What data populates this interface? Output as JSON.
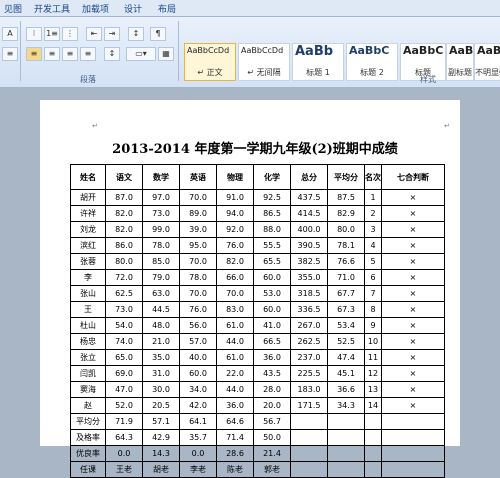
{
  "ribbon": {
    "tabs": [
      "见图",
      "开发工具",
      "加载项",
      "设计",
      "布局"
    ],
    "groups": {
      "paragraph": "段落",
      "styles": "样式"
    },
    "styles": [
      {
        "sample": "AaBbCcDd",
        "name": "↵ 正文"
      },
      {
        "sample": "AaBbCcDd",
        "name": "↵ 无间隔"
      },
      {
        "sample": "AaBb",
        "name": "标题 1"
      },
      {
        "sample": "AaBbC",
        "name": "标题 2"
      },
      {
        "sample": "AaBbC",
        "name": "标题"
      },
      {
        "sample": "AaBbC",
        "name": "副标题"
      },
      {
        "sample": "AaBbC",
        "name": "不明显强调"
      }
    ]
  },
  "document": {
    "title": "2013-2014 年度第一学期九年级(2)班期中成绩",
    "headers": [
      "姓名",
      "语文",
      "数学",
      "英语",
      "物理",
      "化学",
      "总分",
      "平均分",
      "名次",
      "七合判断"
    ],
    "rows": [
      [
        "胡开",
        "87.0",
        "97.0",
        "70.0",
        "91.0",
        "92.5",
        "437.5",
        "87.5",
        "1",
        "×"
      ],
      [
        "许祥",
        "82.0",
        "73.0",
        "89.0",
        "94.0",
        "86.5",
        "414.5",
        "82.9",
        "2",
        "×"
      ],
      [
        "刘龙",
        "82.0",
        "99.0",
        "39.0",
        "92.0",
        "88.0",
        "400.0",
        "80.0",
        "3",
        "×"
      ],
      [
        "滨红",
        "86.0",
        "78.0",
        "95.0",
        "76.0",
        "55.5",
        "390.5",
        "78.1",
        "4",
        "×"
      ],
      [
        "张蓉",
        "80.0",
        "85.0",
        "70.0",
        "82.0",
        "65.5",
        "382.5",
        "76.6",
        "5",
        "×"
      ],
      [
        "李",
        "72.0",
        "79.0",
        "78.0",
        "66.0",
        "60.0",
        "355.0",
        "71.0",
        "6",
        "×"
      ],
      [
        "张山",
        "62.5",
        "63.0",
        "70.0",
        "70.0",
        "53.0",
        "318.5",
        "67.7",
        "7",
        "×"
      ],
      [
        "王",
        "73.0",
        "44.5",
        "76.0",
        "83.0",
        "60.0",
        "336.5",
        "67.3",
        "8",
        "×"
      ],
      [
        "杜山",
        "54.0",
        "48.0",
        "56.0",
        "61.0",
        "41.0",
        "267.0",
        "53.4",
        "9",
        "×"
      ],
      [
        "杨忠",
        "74.0",
        "21.0",
        "57.0",
        "44.0",
        "66.5",
        "262.5",
        "52.5",
        "10",
        "×"
      ],
      [
        "张立",
        "65.0",
        "35.0",
        "40.0",
        "61.0",
        "36.0",
        "237.0",
        "47.4",
        "11",
        "×"
      ],
      [
        "闫凯",
        "69.0",
        "31.0",
        "60.0",
        "22.0",
        "43.5",
        "225.5",
        "45.1",
        "12",
        "×"
      ],
      [
        "窦海",
        "47.0",
        "30.0",
        "34.0",
        "44.0",
        "28.0",
        "183.0",
        "36.6",
        "13",
        "×"
      ],
      [
        "赵",
        "52.0",
        "20.5",
        "42.0",
        "36.0",
        "20.0",
        "171.5",
        "34.3",
        "14",
        "×"
      ],
      [
        "平均分",
        "71.9",
        "57.1",
        "64.1",
        "64.6",
        "56.7",
        "",
        "",
        "",
        ""
      ],
      [
        "及格率",
        "64.3",
        "42.9",
        "35.7",
        "71.4",
        "50.0",
        "",
        "",
        "",
        ""
      ],
      [
        "优良率",
        "0.0",
        "14.3",
        "0.0",
        "28.6",
        "21.4",
        "",
        "",
        "",
        ""
      ],
      [
        "任课",
        "王老",
        "胡老",
        "李老",
        "陈老",
        "郭老",
        "",
        "",
        "",
        ""
      ]
    ]
  },
  "colors": {
    "ribbon_bg": "#dfe9f5",
    "page_bg": "#ffffff",
    "workspace_bg": "#a9b6c6"
  }
}
